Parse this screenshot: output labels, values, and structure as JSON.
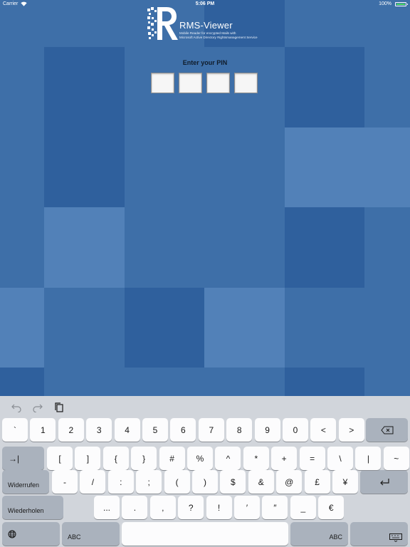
{
  "status_bar": {
    "carrier": "Carrier",
    "time": "5:06 PM",
    "battery": "100%",
    "battery_level_pct": 100
  },
  "logo": {
    "title": "RMS-Viewer",
    "subtitle_line1": "Mobile Reader for encrypted Mails with",
    "subtitle_line2": "Microsoft Active Directory Rightsmanagement Service"
  },
  "pin": {
    "label": "Enter your PIN",
    "digits": [
      "",
      "",
      "",
      ""
    ]
  },
  "colors": {
    "tile_dark": "#2f609d",
    "tile_mid": "#3e6fa8",
    "tile_light": "#5281b8",
    "keyboard_bg": "#d1d5db",
    "key_light": "#fcfcfd",
    "key_dark": "#aab2bd"
  },
  "keyboard": {
    "toolbar": {
      "undo_icon": "undo-arrow-icon",
      "redo_icon": "redo-arrow-icon",
      "paste_icon": "clipboard-icon"
    },
    "row1": [
      "`",
      "1",
      "2",
      "3",
      "4",
      "5",
      "6",
      "7",
      "8",
      "9",
      "0",
      "<",
      ">"
    ],
    "row1_delete_icon": "backspace-icon",
    "row2_tab": "→|",
    "row2": [
      "[",
      "]",
      "{",
      "}",
      "#",
      "%",
      "^",
      "*",
      "+",
      "=",
      "\\",
      "|",
      "~"
    ],
    "row3_left": "Widerrufen",
    "row3": [
      "-",
      "/",
      ":",
      ";",
      "(",
      ")",
      "$",
      "&",
      "@",
      "£",
      "¥"
    ],
    "row3_return_icon": "return-icon",
    "row4_left": "Wiederholen",
    "row4": [
      "...",
      ".",
      ",",
      "?",
      "!",
      "′",
      "″",
      "_",
      "€"
    ],
    "row5_globe_icon": "globe-icon",
    "row5_abc_left": "ABC",
    "row5_abc_right": "ABC",
    "row5_dismiss_icon": "keyboard-dismiss-icon"
  }
}
